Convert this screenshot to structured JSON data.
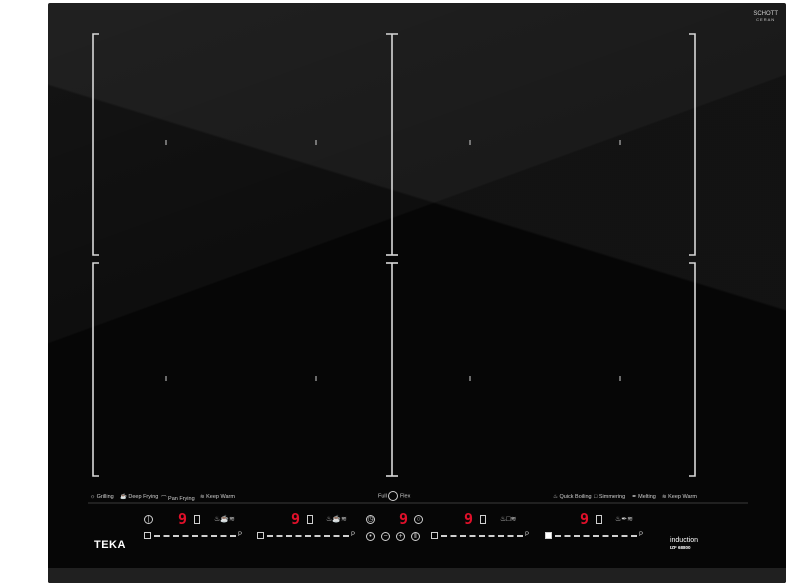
{
  "brand": {
    "logo": "TEKA",
    "glass_logo_line1": "SCHOTT",
    "glass_logo_line2": "CERAN",
    "tagline": "induction",
    "model": "IZF 68800"
  },
  "functions_left": [
    {
      "icon": "grilling-icon",
      "label": "Grilling"
    },
    {
      "icon": "deep-frying-icon",
      "label": "Deep Frying"
    },
    {
      "icon": "pan-frying-icon",
      "label": "Pan Frying"
    },
    {
      "icon": "keep-warm-icon",
      "label": "Keep Warm"
    }
  ],
  "functions_center": {
    "label_full": "Full",
    "label_flex": "Flex",
    "icon": "full-flex-icon"
  },
  "functions_right": [
    {
      "icon": "quick-boiling-icon",
      "label": "Quick Boiling"
    },
    {
      "icon": "simmering-icon",
      "label": "Simmering"
    },
    {
      "icon": "melting-icon",
      "label": "Melting"
    },
    {
      "icon": "keep-warm-icon",
      "label": "Keep Warm"
    }
  ],
  "displays": [
    {
      "zone": "front-left",
      "value": "9"
    },
    {
      "zone": "rear-left",
      "value": "9"
    },
    {
      "zone": "timer",
      "value": "9"
    },
    {
      "zone": "rear-right",
      "value": "9"
    },
    {
      "zone": "front-right",
      "value": "9"
    }
  ],
  "slider_end_label": "P",
  "colors": {
    "glass": "#060606",
    "display_red": "#e0102a",
    "markings": "#d8d8d8"
  }
}
